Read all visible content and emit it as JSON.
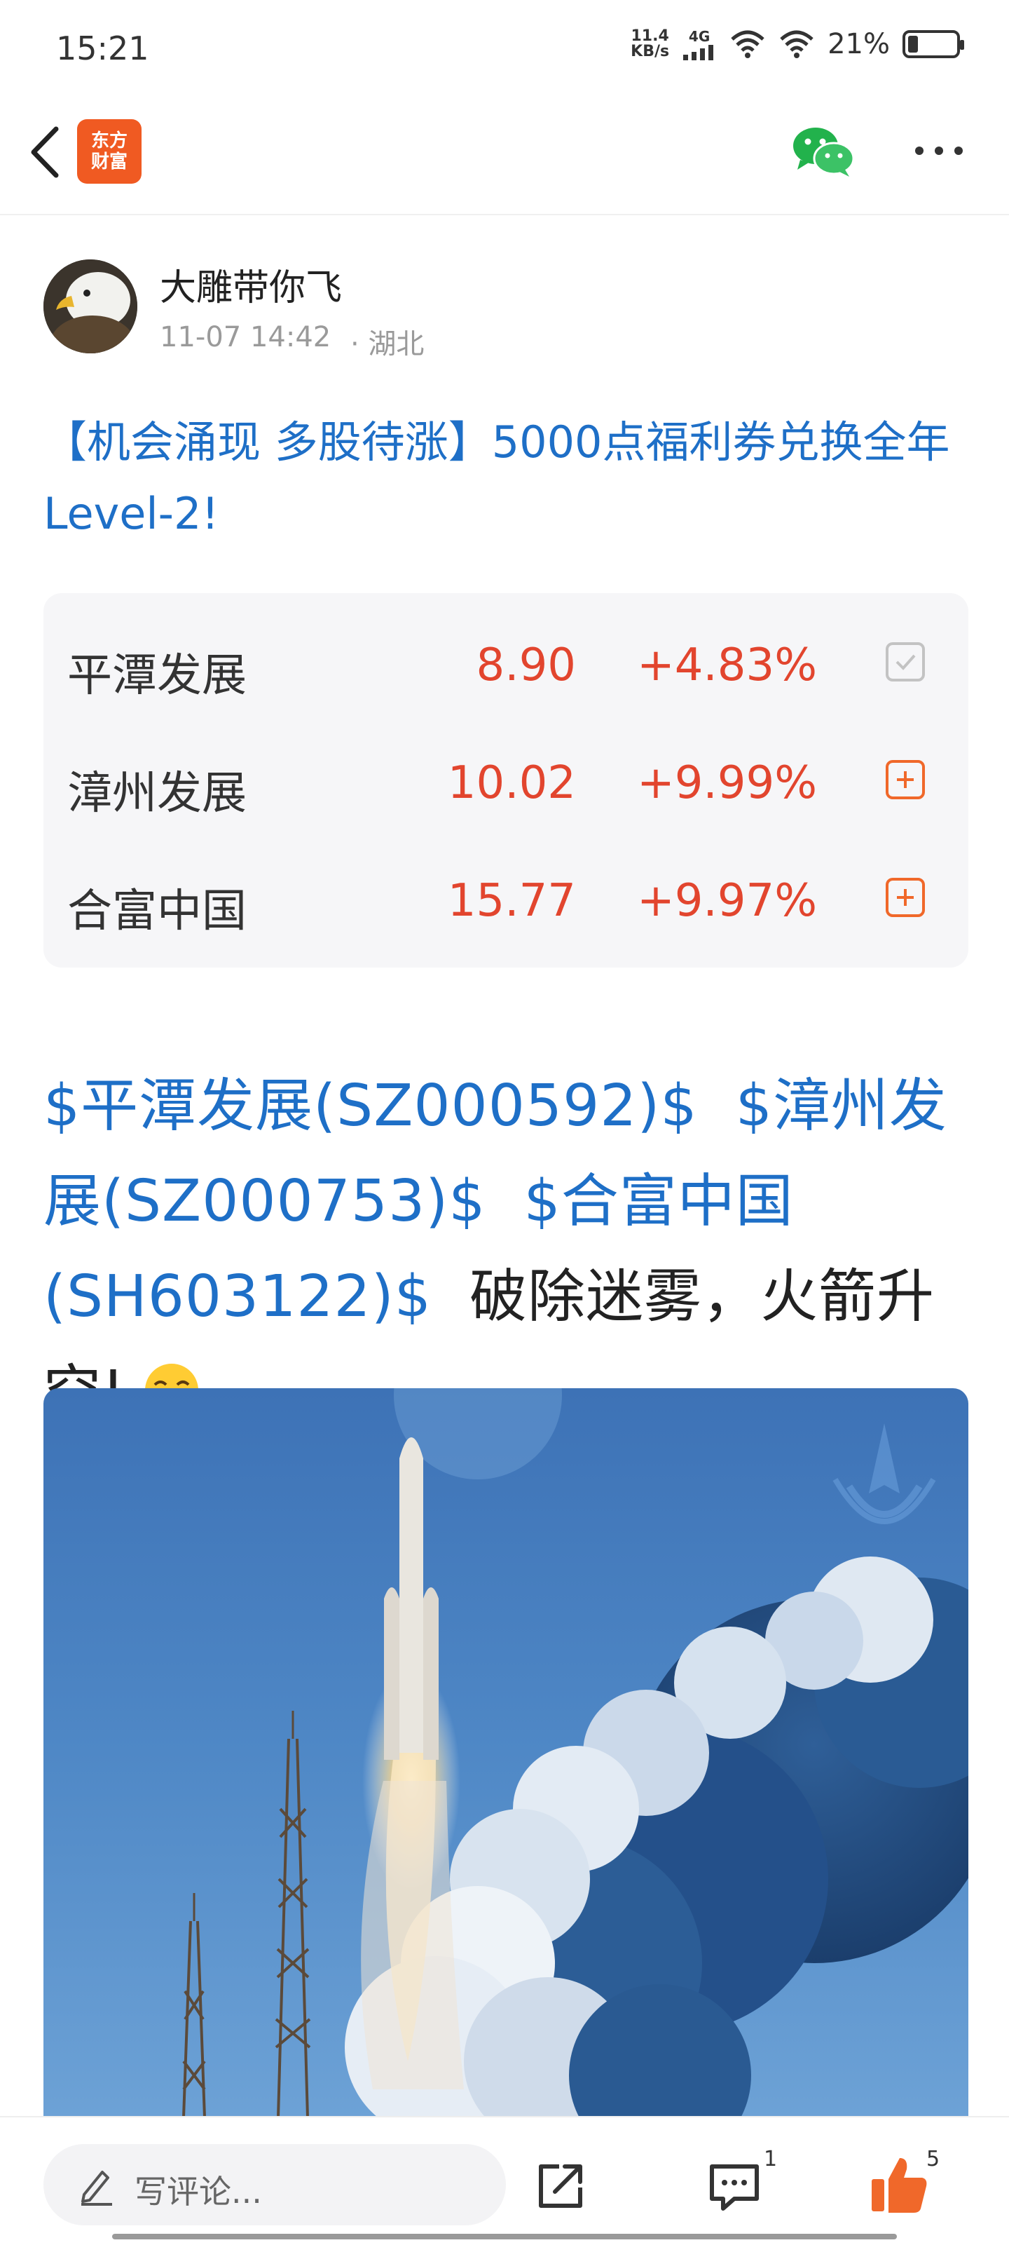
{
  "status_bar": {
    "time": "15:21",
    "net_speed_value": "11.4",
    "net_speed_unit": "KB/s",
    "signal_label": "4G",
    "battery_percent": "21%",
    "battery_level": 0.21
  },
  "nav": {
    "back_icon": "chevron-left-icon",
    "brand_line1": "东方",
    "brand_line2": "财富",
    "brand_color": "#f05a22",
    "share_icon": "wechat-icon",
    "more_icon": "more-horizontal-icon"
  },
  "author": {
    "name": "大雕带你飞",
    "time": "11-07 14:42",
    "location": "· 湖北"
  },
  "post": {
    "title": "【机会涌现 多股待涨】5000点福利券兑换全年Level-2!",
    "body_links": [
      "$平潭发展(SZ000592)$",
      "$漳州发展(SZ000753)$",
      "$合富中国(SH603122)$"
    ],
    "body_text": "破除迷雾，火箭升空!",
    "body_emoji": "laugh-cry-emoji"
  },
  "stocks": [
    {
      "name": "平潭发展",
      "price": "8.90",
      "change": "+4.83%",
      "in_watchlist": true
    },
    {
      "name": "漳州发展",
      "price": "10.02",
      "change": "+9.99%",
      "in_watchlist": false
    },
    {
      "name": "合富中国",
      "price": "15.77",
      "change": "+9.97%",
      "in_watchlist": false
    }
  ],
  "bottom_bar": {
    "comment_placeholder": "写评论...",
    "comment_count": "1",
    "like_count": "5",
    "like_color": "#f0682a"
  },
  "colors": {
    "link_blue": "#1e6fc7",
    "up_red": "#e2452e",
    "add_orange": "#f0682a"
  }
}
